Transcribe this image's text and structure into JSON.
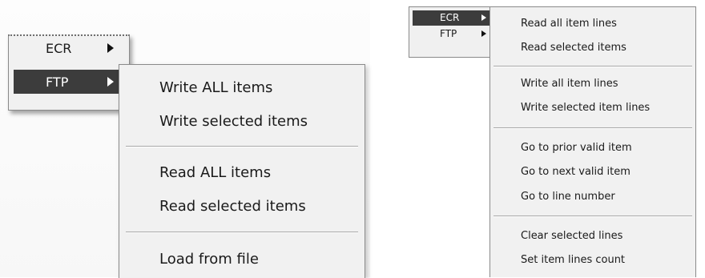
{
  "left_panel": {
    "main_menu": [
      {
        "label": "ECR",
        "selected": false
      },
      {
        "label": "FTP",
        "selected": true
      }
    ],
    "submenu": [
      "Write ALL items",
      "Write selected items",
      "Read ALL items",
      "Read selected items",
      "Load from file"
    ]
  },
  "right_panel": {
    "main_menu": [
      {
        "label": "ECR",
        "selected": true
      },
      {
        "label": "FTP",
        "selected": false
      }
    ],
    "submenu": [
      "Read all item lines",
      "Read selected items",
      "Write all item lines",
      "Write selected item lines",
      "Go to prior valid item",
      "Go to next valid item",
      "Go to line number",
      "Clear selected lines",
      "Set item lines count"
    ]
  },
  "colors": {
    "menu_bg": "#f1f1f1",
    "selected_bg": "#3c3c3c",
    "selected_text": "#ffffff",
    "text": "#1a1a1a"
  },
  "icons": {
    "submenu_arrow": "triangle-right-icon"
  }
}
